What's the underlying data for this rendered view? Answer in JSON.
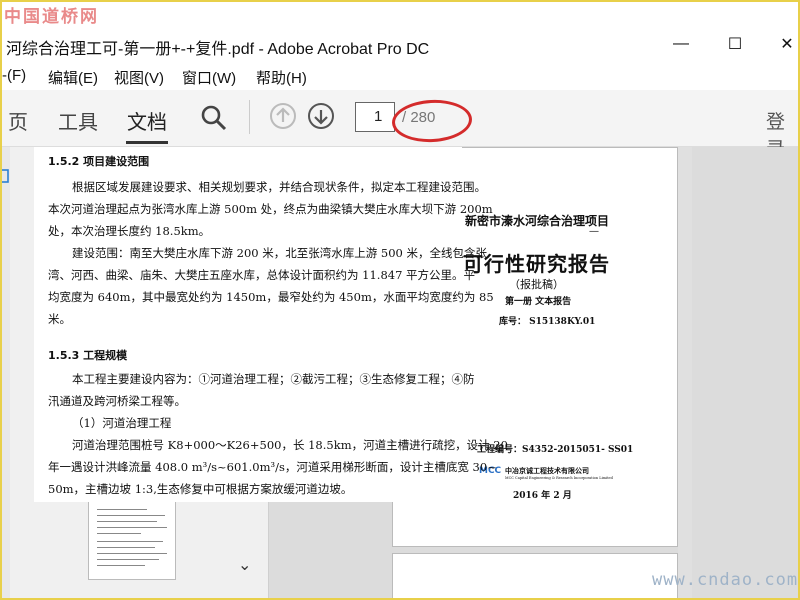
{
  "watermark_top": "中国道桥网",
  "watermark_bottom": "www.cndao.com",
  "window": {
    "title": "河综合治理工可-第一册+-+复件.pdf - Adobe Acrobat Pro DC",
    "min": "—",
    "max": "☐",
    "close": "✕"
  },
  "menu": [
    "‐(F)",
    "编辑(E)",
    "视图(V)",
    "窗口(W)",
    "帮助(H)"
  ],
  "toolbar": {
    "tabs": [
      "页",
      "工具",
      "文档"
    ],
    "active_tab": "文档",
    "page_current": "1",
    "page_total": "/ 280",
    "login": "登录"
  },
  "document": {
    "heading1": "1.5.2  项目建设范围",
    "para1": [
      "根据区域发展建设要求、相关规划要求，并结合现状条件，拟定本工程建设范围。",
      "本次河道治理起点为张湾水库上游 500m 处，终点为曲梁镇大樊庄水库大坝下游 200m",
      "处，本次治理长度约 18.5km。"
    ],
    "para2": [
      "建设范围：南至大樊庄水库下游 200 米，北至张湾水库上游 500 米，全线包含张",
      "湾、河西、曲梁、庙朱、大樊庄五座水库，总体设计面积约为 11.847 平方公里。平",
      "均宽度为 640m，其中最宽处约为 1450m，最窄处约为 450m，水面平均宽度约为 85",
      "米。"
    ],
    "heading2": "1.5.3 工程规模",
    "para3": [
      "本工程主要建设内容为：①河道治理工程；②截污工程；③生态修复工程；④防",
      "汛通道及跨河桥梁工程等。"
    ],
    "item1": "（1）河道治理工程",
    "para4": [
      "河道治理范围桩号 K8+000～K26+500，长 18.5km，河道主槽进行疏挖，设计 20",
      "年一遇设计洪峰流量 408.0 m³/s~601.0m³/s，河道采用梯形断面，设计主槽底宽 30~",
      "50m，主槽边坡 1:3,生态修复中可根据方案放缓河道边坡。"
    ]
  },
  "cover": {
    "project": "新密市溱水河综合治理项目",
    "dash": "—",
    "title": "可行性研究报告",
    "subtitle": "（报批稿）",
    "volume": "第一册   文本报告",
    "serial": "库号：  S15138KY.01",
    "project_no": "工程编号：S4352-2015051- SS01",
    "company": "中冶京诚工程技术有限公司",
    "company_en": "MCC Capital Engineering & Research Incorporation Limited",
    "logo": "MCC",
    "date": "2016 年 2 月"
  },
  "colors": {
    "oval": "#d42b2b",
    "frame": "#e8d04a"
  }
}
